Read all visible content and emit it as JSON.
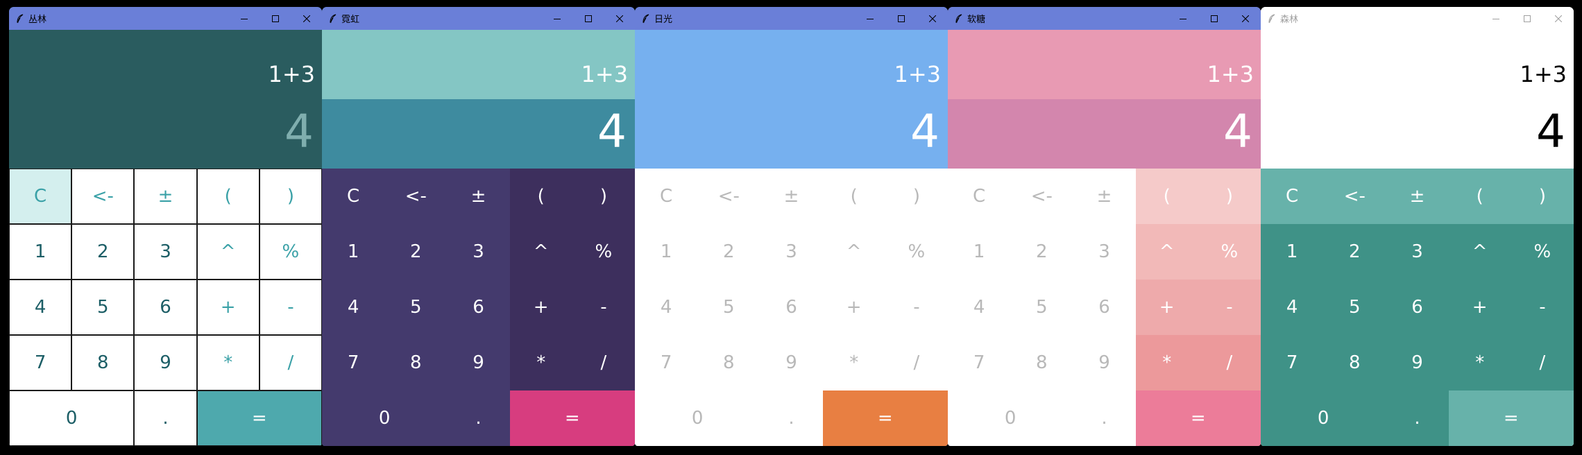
{
  "keys_layout": [
    {
      "label": "C",
      "kind": "op"
    },
    {
      "label": "<-",
      "kind": "op"
    },
    {
      "label": "±",
      "kind": "op"
    },
    {
      "label": "(",
      "kind": "op"
    },
    {
      "label": ")",
      "kind": "op"
    },
    {
      "label": "1",
      "kind": "num"
    },
    {
      "label": "2",
      "kind": "num"
    },
    {
      "label": "3",
      "kind": "num"
    },
    {
      "label": "^",
      "kind": "op"
    },
    {
      "label": "%",
      "kind": "op"
    },
    {
      "label": "4",
      "kind": "num"
    },
    {
      "label": "5",
      "kind": "num"
    },
    {
      "label": "6",
      "kind": "num"
    },
    {
      "label": "+",
      "kind": "op"
    },
    {
      "label": "-",
      "kind": "op"
    },
    {
      "label": "7",
      "kind": "num"
    },
    {
      "label": "8",
      "kind": "num"
    },
    {
      "label": "9",
      "kind": "num"
    },
    {
      "label": "*",
      "kind": "op"
    },
    {
      "label": "/",
      "kind": "op"
    },
    {
      "label": "0",
      "kind": "num",
      "span": 2
    },
    {
      "label": ".",
      "kind": "num"
    },
    {
      "label": "=",
      "kind": "eq",
      "span": 2
    }
  ],
  "windows": [
    {
      "title": "丛林",
      "expression": "1+3",
      "result": "4",
      "colors": {
        "titlebar": "#6a7fd8",
        "title_text": "#000000",
        "expr_bg": "#2a5c5f",
        "result_bg": "#2a5c5f",
        "expr_text": "#ffffff",
        "result_text": "#7faeae"
      }
    },
    {
      "title": "霓虹",
      "expression": "1+3",
      "result": "4",
      "colors": {
        "titlebar": "#6a7fd8",
        "title_text": "#000000",
        "expr_bg": "#84c6c4",
        "result_bg": "#3e8b9f",
        "expr_text": "#ffffff",
        "result_text": "#ffffff"
      }
    },
    {
      "title": "日光",
      "expression": "1+3",
      "result": "4",
      "colors": {
        "titlebar": "#6a7fd8",
        "title_text": "#000000",
        "expr_bg": "#76b0ef",
        "result_bg": "#76b0ef",
        "expr_text": "#ffffff",
        "result_text": "#ffffff"
      }
    },
    {
      "title": "软糖",
      "expression": "1+3",
      "result": "4",
      "colors": {
        "titlebar": "#6a7fd8",
        "title_text": "#000000",
        "expr_bg": "#e89ab3",
        "result_bg": "#d386ad",
        "expr_text": "#ffffff",
        "result_text": "#ffffff"
      }
    },
    {
      "title": "森林",
      "expression": "1+3",
      "result": "4",
      "colors": {
        "titlebar": "#ffffff",
        "title_text": "#a0a0a0",
        "expr_bg": "#ffffff",
        "result_bg": "#ffffff",
        "expr_text": "#000000",
        "result_text": "#000000"
      }
    }
  ],
  "icons": {
    "app": "feather-icon",
    "minimize": "minimize-icon",
    "maximize": "maximize-icon",
    "close": "close-icon"
  }
}
